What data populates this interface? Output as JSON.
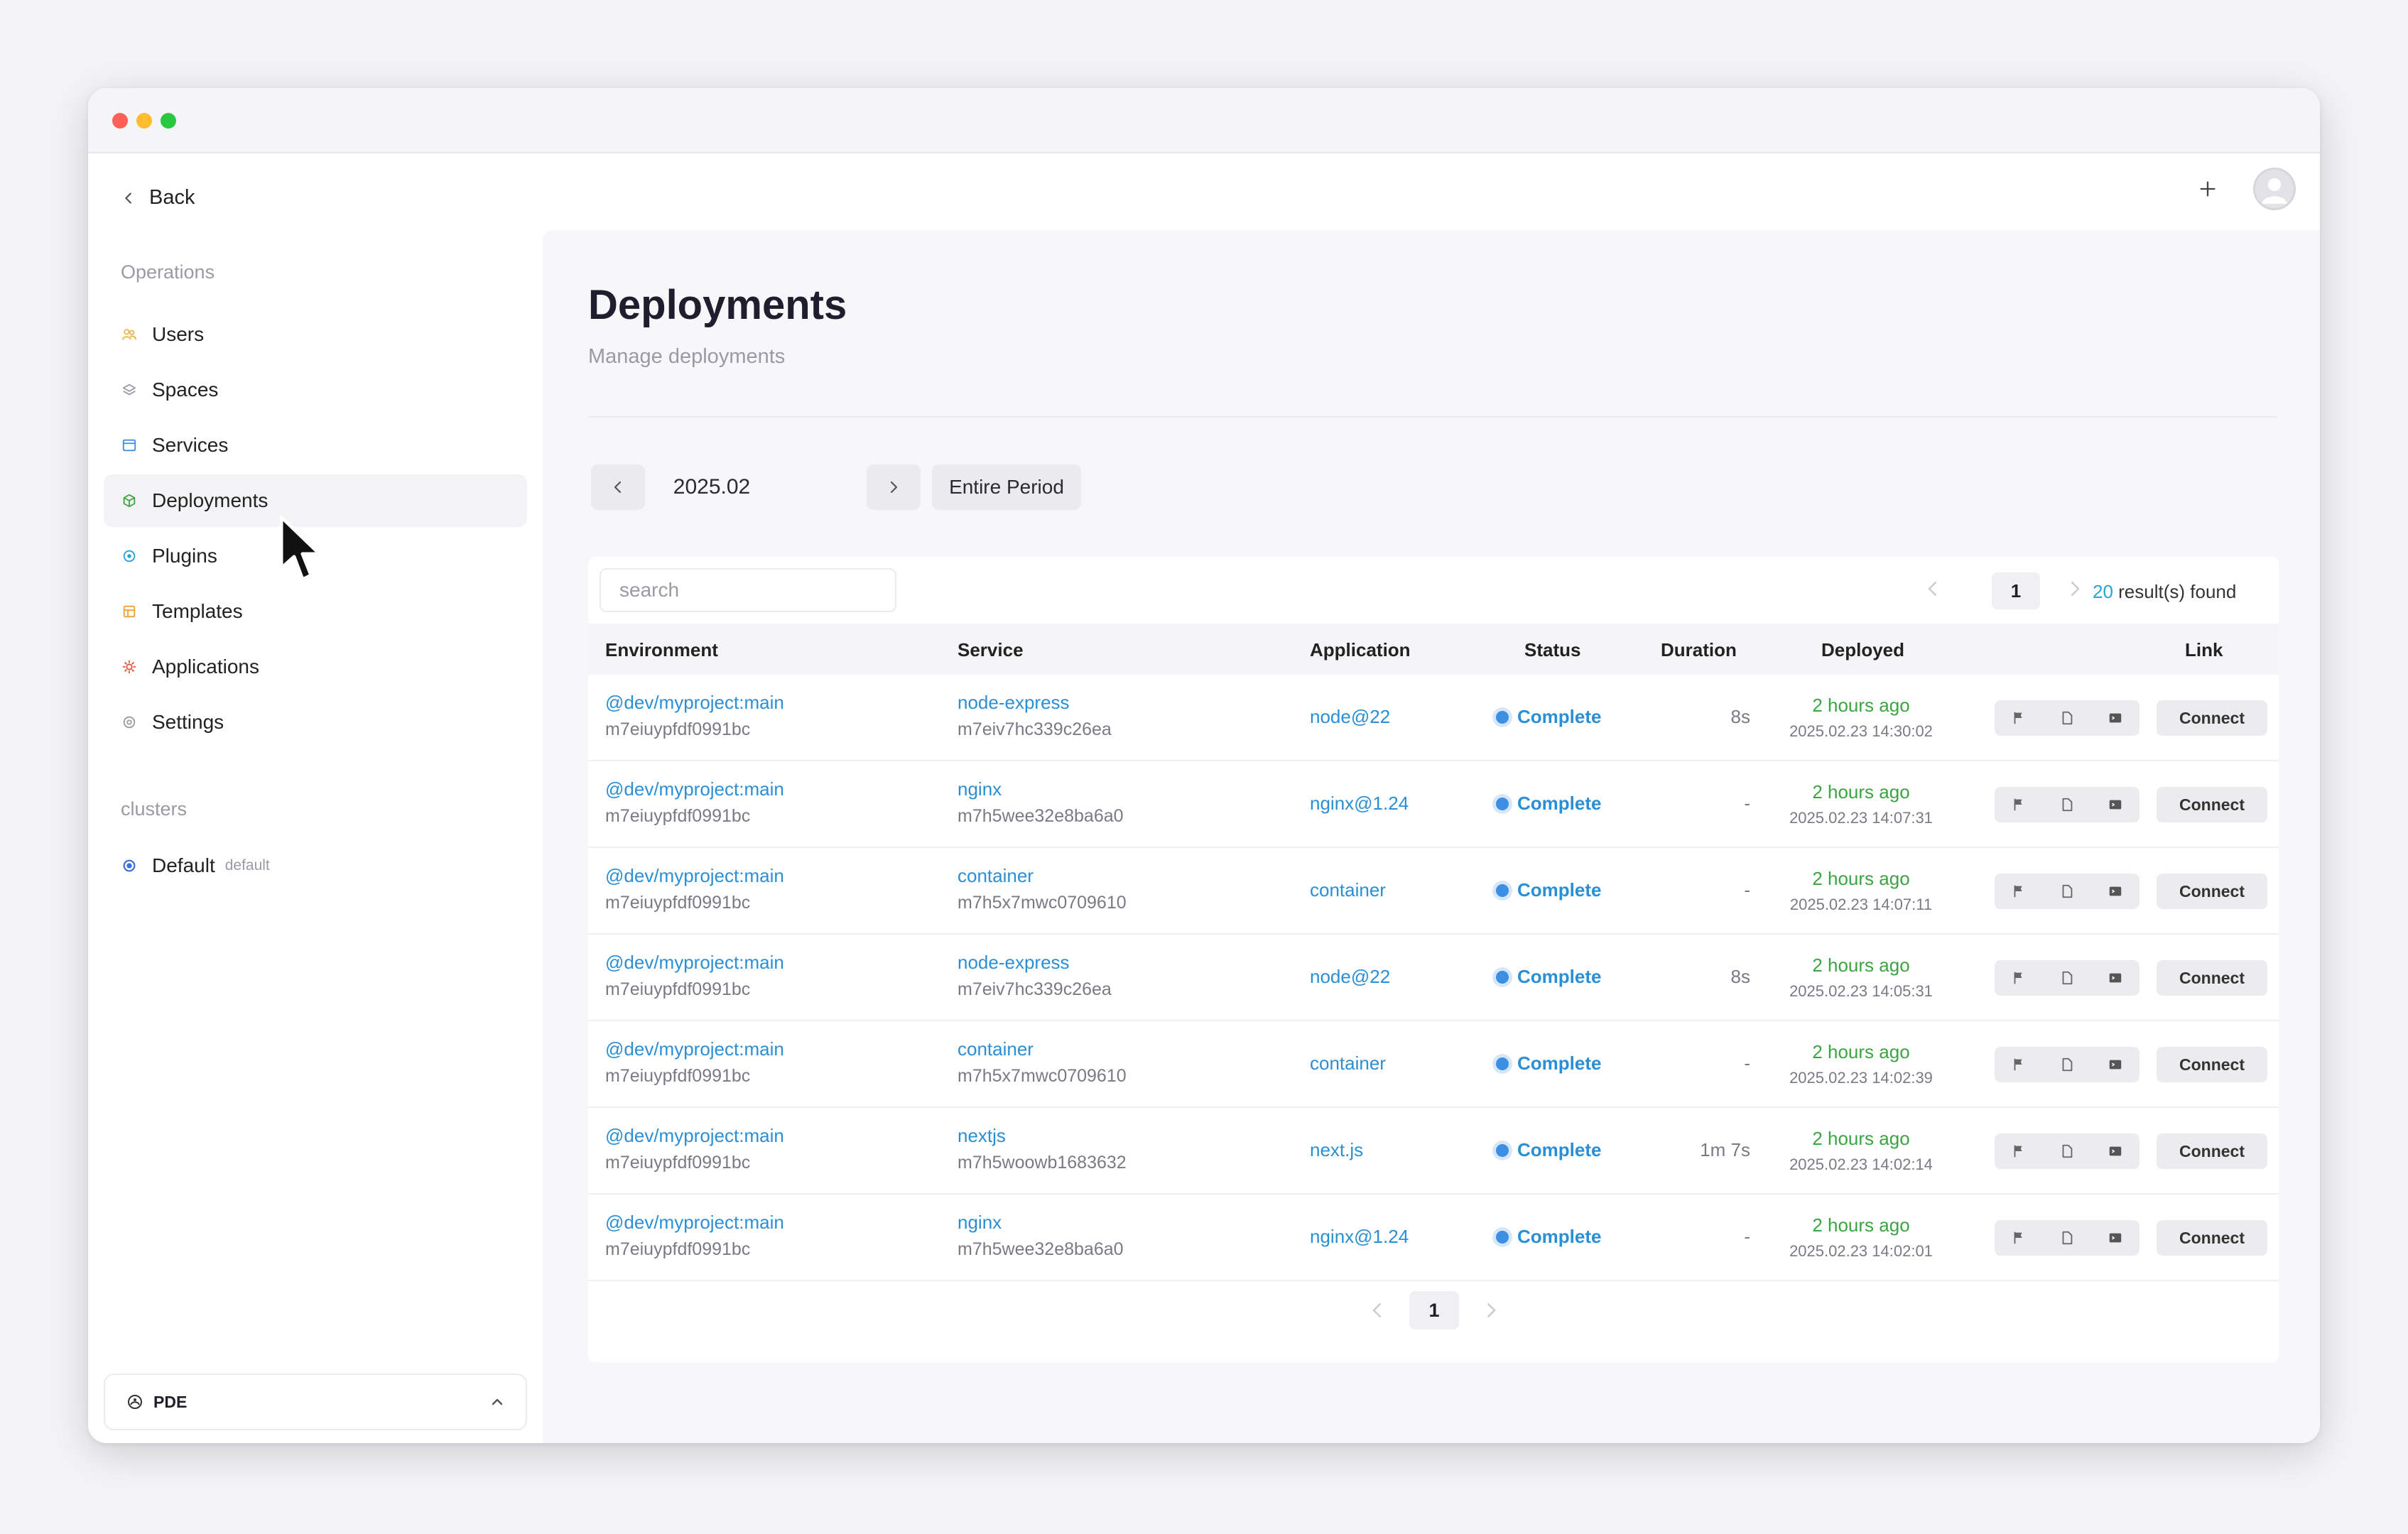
{
  "sidebar": {
    "back_label": "Back",
    "operations_title": "Operations",
    "items": [
      {
        "label": "Users",
        "icon": "users-icon",
        "color": "#f0b54a"
      },
      {
        "label": "Spaces",
        "icon": "layers-icon",
        "color": "#9a9aa3"
      },
      {
        "label": "Services",
        "icon": "window-icon",
        "color": "#3d8fe3"
      },
      {
        "label": "Deployments",
        "icon": "box-icon",
        "color": "#3aa541"
      },
      {
        "label": "Plugins",
        "icon": "plugin-icon",
        "color": "#2aa3d6"
      },
      {
        "label": "Templates",
        "icon": "template-icon",
        "color": "#f0a030"
      },
      {
        "label": "Applications",
        "icon": "gear-icon",
        "color": "#e0573f"
      },
      {
        "label": "Settings",
        "icon": "settings-icon",
        "color": "#9a9aa3"
      }
    ],
    "clusters_title": "clusters",
    "cluster": {
      "label": "Default",
      "sub": "default"
    },
    "footer_label": "PDE"
  },
  "header": {
    "title": "Deployments",
    "subtitle": "Manage deployments"
  },
  "period": {
    "month": "2025.02",
    "entire_label": "Entire Period"
  },
  "table": {
    "search_placeholder": "search",
    "page": "1",
    "result_count": "20",
    "result_suffix": " result(s) found",
    "columns": [
      "Environment",
      "Service",
      "Application",
      "Status",
      "Duration",
      "Deployed",
      "Link"
    ],
    "connect_label": "Connect",
    "rows": [
      {
        "env": "@dev/myproject:main",
        "env_id": "m7eiuypfdf0991bc",
        "service": "node-express",
        "service_id": "m7eiv7hc339c26ea",
        "app": "node@22",
        "status": "Complete",
        "duration": "8s",
        "ago": "2 hours ago",
        "ts": "2025.02.23 14:30:02"
      },
      {
        "env": "@dev/myproject:main",
        "env_id": "m7eiuypfdf0991bc",
        "service": "nginx",
        "service_id": "m7h5wee32e8ba6a0",
        "app": "nginx@1.24",
        "status": "Complete",
        "duration": "-",
        "ago": "2 hours ago",
        "ts": "2025.02.23 14:07:31"
      },
      {
        "env": "@dev/myproject:main",
        "env_id": "m7eiuypfdf0991bc",
        "service": "container",
        "service_id": "m7h5x7mwc0709610",
        "app": "container",
        "status": "Complete",
        "duration": "-",
        "ago": "2 hours ago",
        "ts": "2025.02.23 14:07:11"
      },
      {
        "env": "@dev/myproject:main",
        "env_id": "m7eiuypfdf0991bc",
        "service": "node-express",
        "service_id": "m7eiv7hc339c26ea",
        "app": "node@22",
        "status": "Complete",
        "duration": "8s",
        "ago": "2 hours ago",
        "ts": "2025.02.23 14:05:31"
      },
      {
        "env": "@dev/myproject:main",
        "env_id": "m7eiuypfdf0991bc",
        "service": "container",
        "service_id": "m7h5x7mwc0709610",
        "app": "container",
        "status": "Complete",
        "duration": "-",
        "ago": "2 hours ago",
        "ts": "2025.02.23 14:02:39"
      },
      {
        "env": "@dev/myproject:main",
        "env_id": "m7eiuypfdf0991bc",
        "service": "nextjs",
        "service_id": "m7h5woowb1683632",
        "app": "next.js",
        "status": "Complete",
        "duration": "1m 7s",
        "ago": "2 hours ago",
        "ts": "2025.02.23 14:02:14"
      },
      {
        "env": "@dev/myproject:main",
        "env_id": "m7eiuypfdf0991bc",
        "service": "nginx",
        "service_id": "m7h5wee32e8ba6a0",
        "app": "nginx@1.24",
        "status": "Complete",
        "duration": "-",
        "ago": "2 hours ago",
        "ts": "2025.02.23 14:02:01"
      }
    ]
  }
}
